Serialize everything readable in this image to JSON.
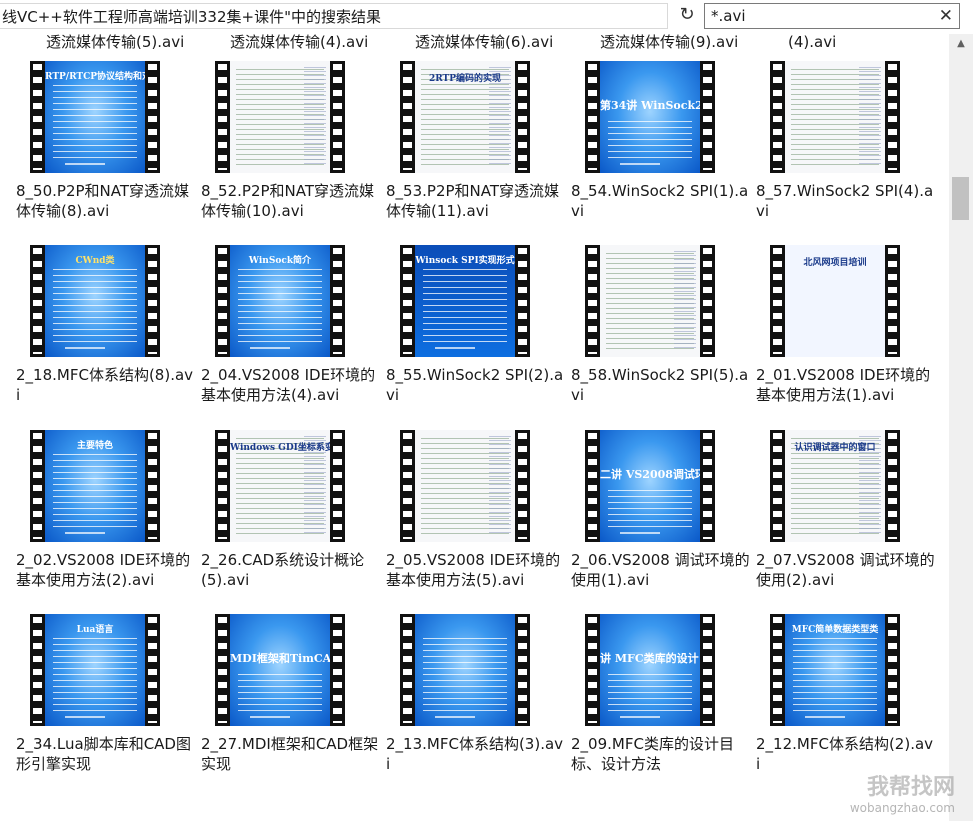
{
  "address_bar": {
    "path_text": "线VC++软件工程师高端培训332集+课件\"中的搜索结果",
    "dropdown_icon": "chevron-down-icon",
    "refresh_icon": "refresh-icon"
  },
  "search": {
    "value": "*.avi",
    "clear_icon": "close-icon"
  },
  "top_partial_row": [
    "透流媒体传输(5).avi",
    "透流媒体传输(4).avi",
    "透流媒体传输(6).avi",
    "透流媒体传输(9).avi",
    "(4).avi"
  ],
  "files": [
    {
      "name": "8_50.P2P和NAT穿透流媒体传输(8).avi",
      "slide_title": "RTP/RTCP协议结构和对照",
      "style": "blue"
    },
    {
      "name": "8_52.P2P和NAT穿透流媒体传输(10).avi",
      "slide_title": "",
      "style": "code"
    },
    {
      "name": "8_53.P2P和NAT穿透流媒体传输(11).avi",
      "slide_title": "2RTP编码的实现",
      "style": "code"
    },
    {
      "name": "8_54.WinSock2 SPI(1).avi",
      "slide_title": "第34讲 WinSock2 SPI",
      "style": "blue-big"
    },
    {
      "name": "8_57.WinSock2 SPI(4).avi",
      "slide_title": "",
      "style": "code"
    },
    {
      "name": "2_18.MFC体系结构(8).avi",
      "slide_title": "CWnd类",
      "style": "blue"
    },
    {
      "name": "2_04.VS2008 IDE环境的基本使用方法(4).avi",
      "slide_title": "WinSock简介",
      "style": "blue"
    },
    {
      "name": "8_55.WinSock2 SPI(2).avi",
      "slide_title": "Winsock SPI实现形式",
      "style": "dark"
    },
    {
      "name": "8_58.WinSock2 SPI(5).avi",
      "slide_title": "",
      "style": "code"
    },
    {
      "name": "2_01.VS2008 IDE环境的基本使用方法(1).avi",
      "slide_title": "北风网项目培训",
      "style": "white"
    },
    {
      "name": "2_02.VS2008 IDE环境的基本使用方法(2).avi",
      "slide_title": "主要特色",
      "style": "blue"
    },
    {
      "name": "2_26.CAD系统设计概论(5).avi",
      "slide_title": "Windows GDI坐标系变换",
      "style": "code"
    },
    {
      "name": "2_05.VS2008 IDE环境的基本使用方法(5).avi",
      "slide_title": "",
      "style": "code"
    },
    {
      "name": "2_06.VS2008 调试环境的使用(1).avi",
      "slide_title": "二讲 VS2008调试环",
      "style": "blue-big"
    },
    {
      "name": "2_07.VS2008 调试环境的使用(2).avi",
      "slide_title": "认识调试器中的窗口",
      "style": "code"
    },
    {
      "name": "2_34.Lua脚本库和CAD图形引擎实现",
      "slide_title": "Lua语言",
      "style": "blue"
    },
    {
      "name": "2_27.MDI框架和CAD框架实现",
      "slide_title": "MDI框架和TimCAD框架",
      "style": "blue-big"
    },
    {
      "name": "2_13.MFC体系结构(3).avi",
      "slide_title": "",
      "style": "blue"
    },
    {
      "name": "2_09.MFC类库的设计目标、设计方法",
      "slide_title": "讲 MFC类库的设计目",
      "style": "blue-big"
    },
    {
      "name": "2_12.MFC体系结构(2).avi",
      "slide_title": "MFC简单数据类型类",
      "style": "blue"
    }
  ],
  "watermark": {
    "big": "我帮找网",
    "small": "wobangzhao.com"
  }
}
